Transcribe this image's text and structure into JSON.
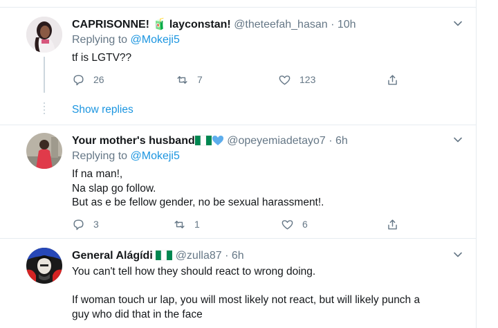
{
  "tweets": [
    {
      "name": "CAPRISONNE! 🧃 layconstan!",
      "handle": "@theteefah_hasan · 10h",
      "replying_prefix": "Replying to ",
      "replying_to": "@Mokeji5",
      "lines": [
        "tf is LGTV??"
      ],
      "reply_count": "26",
      "retweet_count": "7",
      "like_count": "123",
      "show_replies": "Show replies"
    },
    {
      "name": "Your mother's husband",
      "handle": "@opeyemiadetayo7 · 6h",
      "replying_prefix": "Replying to ",
      "replying_to": "@Mokeji5",
      "lines": [
        "If na man!,",
        "Na slap go follow.",
        "But as e be fellow gender, no be sexual harassment!."
      ],
      "reply_count": "3",
      "retweet_count": "1",
      "like_count": "6"
    },
    {
      "name": "General Alágídi",
      "handle": "@zulla87 · 6h",
      "lines": [
        "You can't tell how they should react to wrong doing.",
        "",
        "If woman touch ur lap, you will most likely not react, but will likely punch a",
        "guy who did that in the face"
      ]
    }
  ],
  "colors": {
    "accent": "#1b95e0",
    "secondary_text": "#657786",
    "divider": "#e6ecf0",
    "flag_green": "#008751",
    "heart_blue": "#5dadec"
  }
}
